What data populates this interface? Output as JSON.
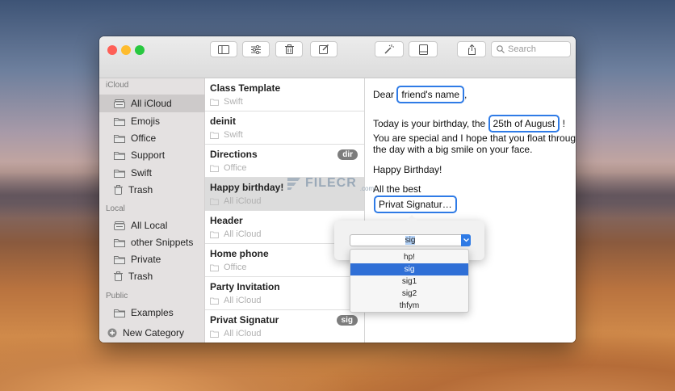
{
  "toolbar": {
    "buttons": [
      "sidebar-toggle",
      "settings-sliders",
      "trash",
      "compose",
      "magic-wand",
      "preview-pane",
      "share"
    ],
    "search_placeholder": "Search"
  },
  "sidebar": {
    "sections": [
      {
        "header": "iCloud",
        "items": [
          {
            "label": "All iCloud",
            "icon": "tray-stack-icon",
            "selected": true
          },
          {
            "label": "Emojis",
            "icon": "folder-icon"
          },
          {
            "label": "Office",
            "icon": "folder-icon"
          },
          {
            "label": "Support",
            "icon": "folder-icon"
          },
          {
            "label": "Swift",
            "icon": "folder-icon"
          },
          {
            "label": "Trash",
            "icon": "trash-icon"
          }
        ]
      },
      {
        "header": "Local",
        "items": [
          {
            "label": "All Local",
            "icon": "tray-stack-icon"
          },
          {
            "label": "other Snippets",
            "icon": "folder-icon"
          },
          {
            "label": "Private",
            "icon": "folder-icon"
          },
          {
            "label": "Trash",
            "icon": "trash-icon"
          }
        ]
      },
      {
        "header": "Public",
        "items": [
          {
            "label": "Examples",
            "icon": "folder-icon"
          }
        ]
      }
    ],
    "new_category": "New Category"
  },
  "snippets": [
    {
      "title": "Class Template",
      "folder": "Swift",
      "badge": ""
    },
    {
      "title": "deinit",
      "folder": "Swift",
      "badge": ""
    },
    {
      "title": "Directions",
      "folder": "Office",
      "badge": "dir"
    },
    {
      "title": "Happy birthday!",
      "folder": "All iCloud",
      "badge": "",
      "selected": true
    },
    {
      "title": "Header",
      "folder": "All iCloud",
      "badge": ""
    },
    {
      "title": "Home phone",
      "folder": "Office",
      "badge": ""
    },
    {
      "title": "Party Invitation",
      "folder": "All iCloud",
      "badge": ""
    },
    {
      "title": "Privat Signatur",
      "folder": "All iCloud",
      "badge": "sig"
    }
  ],
  "editor": {
    "dear": "Dear",
    "name_token": "friend's name",
    "comma": ",",
    "today": "Today is your birthday, the",
    "date_token": "25th of August",
    "bang": "!",
    "line1": "You are special and I hope that you float through",
    "line2": "the day with a big smile on your face.",
    "happy": "Happy Birthday!",
    "best": "All the best",
    "sig_token": "Privat Signatur…"
  },
  "popover": {
    "value": "sig",
    "options": [
      "hp!",
      "sig",
      "sig1",
      "sig2",
      "thfym"
    ],
    "selected_index": 1
  },
  "watermark": {
    "name": "FILECR",
    "domain": ".com"
  },
  "colors": {
    "accent": "#2f7be6",
    "close": "#fe5f57",
    "minimize": "#febc2e",
    "zoom": "#28c840"
  }
}
